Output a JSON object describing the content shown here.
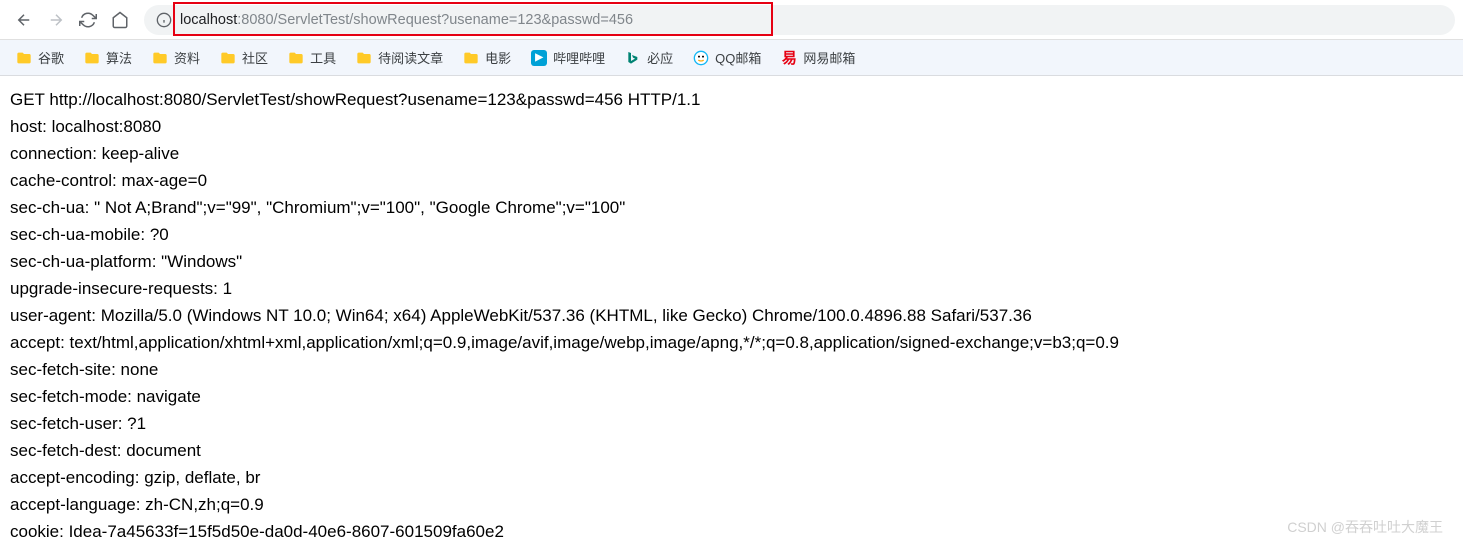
{
  "address": {
    "host": "localhost",
    "port": ":8080",
    "path": "/ServletTest/showRequest?usename=123&passwd=456"
  },
  "bookmarks": [
    {
      "label": "谷歌",
      "type": "folder"
    },
    {
      "label": "算法",
      "type": "folder"
    },
    {
      "label": "资料",
      "type": "folder"
    },
    {
      "label": "社区",
      "type": "folder"
    },
    {
      "label": "工具",
      "type": "folder"
    },
    {
      "label": "待阅读文章",
      "type": "folder"
    },
    {
      "label": "电影",
      "type": "folder"
    },
    {
      "label": "哔哩哔哩",
      "type": "bilibili"
    },
    {
      "label": "必应",
      "type": "bing"
    },
    {
      "label": "QQ邮箱",
      "type": "qq"
    },
    {
      "label": "网易邮箱",
      "type": "netease"
    }
  ],
  "lines": [
    "GET http://localhost:8080/ServletTest/showRequest?usename=123&passwd=456 HTTP/1.1",
    "host: localhost:8080",
    "connection: keep-alive",
    "cache-control: max-age=0",
    "sec-ch-ua: \" Not A;Brand\";v=\"99\", \"Chromium\";v=\"100\", \"Google Chrome\";v=\"100\"",
    "sec-ch-ua-mobile: ?0",
    "sec-ch-ua-platform: \"Windows\"",
    "upgrade-insecure-requests: 1",
    "user-agent: Mozilla/5.0 (Windows NT 10.0; Win64; x64) AppleWebKit/537.36 (KHTML, like Gecko) Chrome/100.0.4896.88 Safari/537.36",
    "accept: text/html,application/xhtml+xml,application/xml;q=0.9,image/avif,image/webp,image/apng,*/*;q=0.8,application/signed-exchange;v=b3;q=0.9",
    "sec-fetch-site: none",
    "sec-fetch-mode: navigate",
    "sec-fetch-user: ?1",
    "sec-fetch-dest: document",
    "accept-encoding: gzip, deflate, br",
    "accept-language: zh-CN,zh;q=0.9",
    "cookie: Idea-7a45633f=15f5d50e-da0d-40e6-8607-601509fa60e2"
  ],
  "watermark": "CSDN @吞吞吐吐大魔王"
}
